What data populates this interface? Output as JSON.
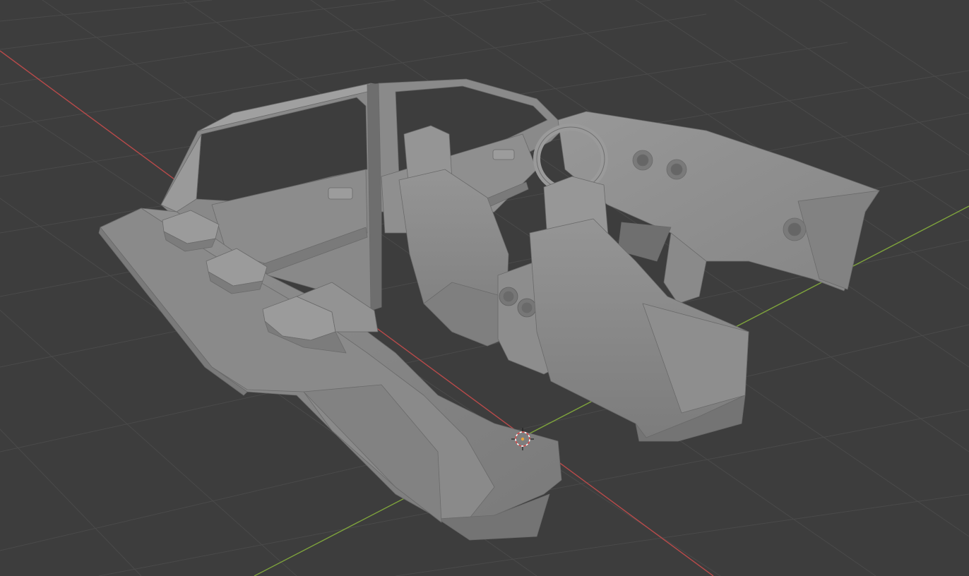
{
  "viewport": {
    "background": "#3d3d3d",
    "grid_color": "#4a4a4a",
    "x_axis_color": "#b84a4a",
    "y_axis_color": "#7ea33c",
    "model_color": "#8e8e8e",
    "model_shadow": "#6f6f6f",
    "model_highlight": "#a4a4a4",
    "model_name": "car-interior-mesh",
    "cursor_icon": "3d-cursor-icon"
  }
}
